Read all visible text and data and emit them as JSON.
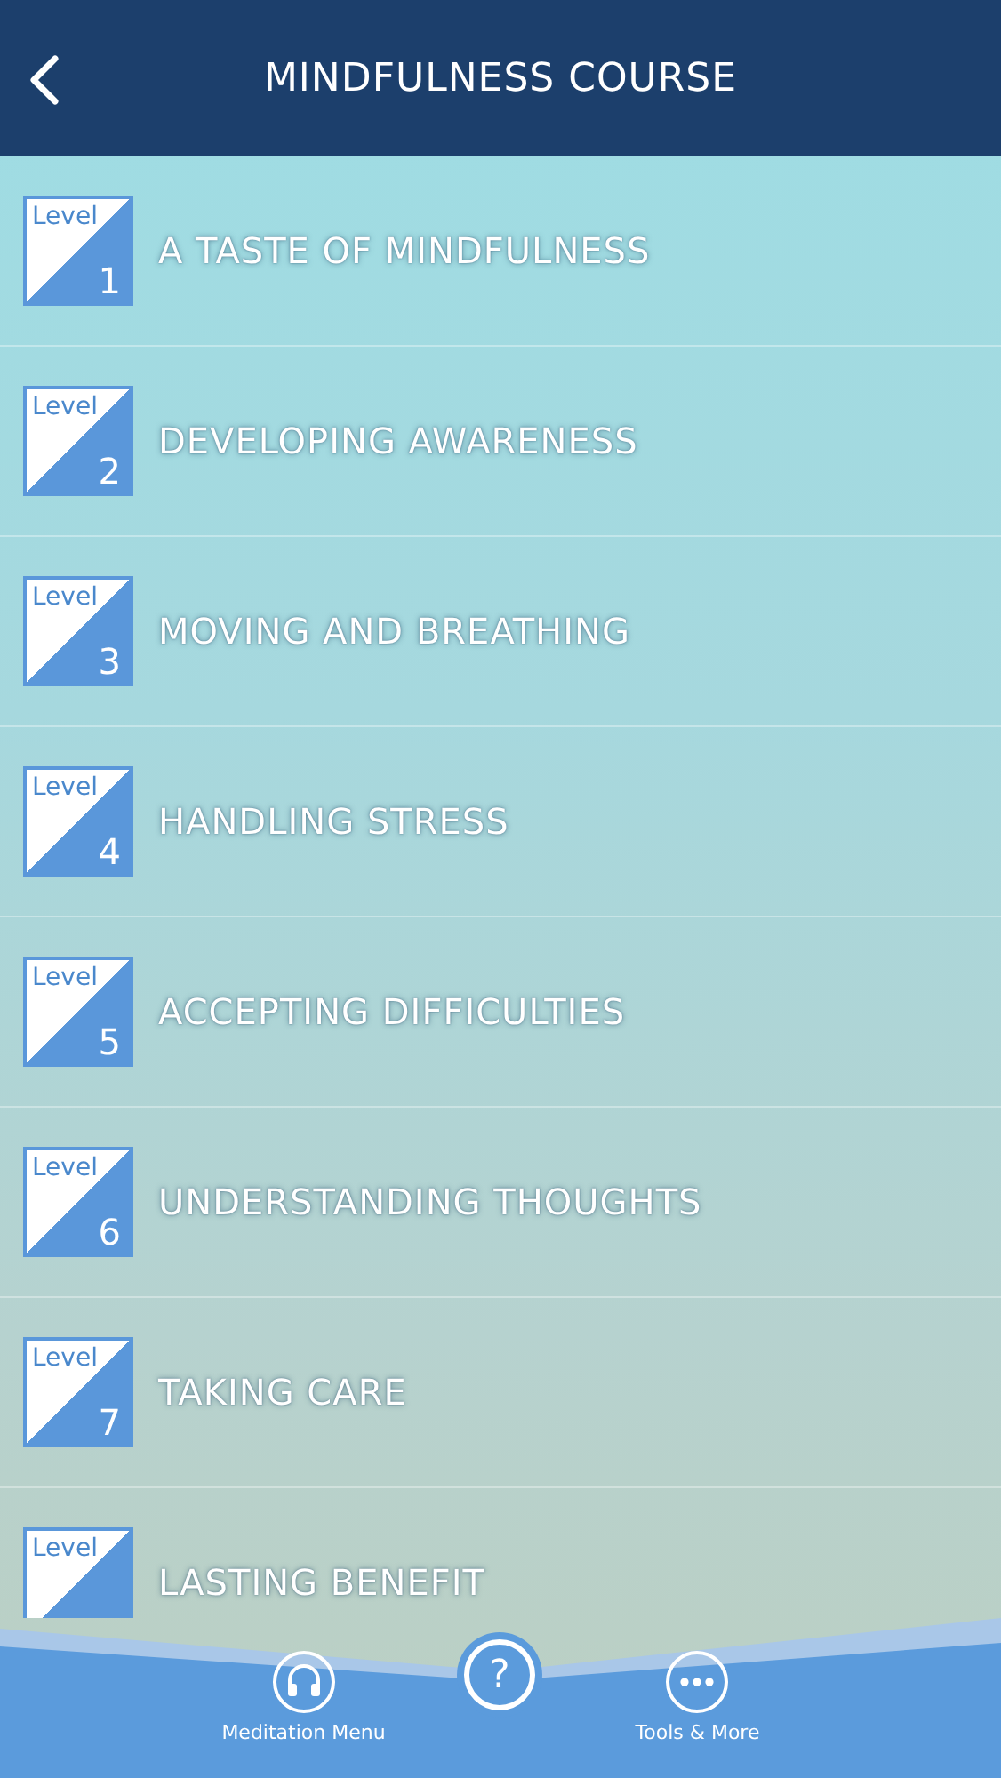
{
  "header": {
    "title": "MINDFULNESS COURSE"
  },
  "levels": [
    {
      "badge": "Level",
      "number": "1",
      "title": "A TASTE OF MINDFULNESS"
    },
    {
      "badge": "Level",
      "number": "2",
      "title": "DEVELOPING AWARENESS"
    },
    {
      "badge": "Level",
      "number": "3",
      "title": "MOVING AND BREATHING"
    },
    {
      "badge": "Level",
      "number": "4",
      "title": "HANDLING STRESS"
    },
    {
      "badge": "Level",
      "number": "5",
      "title": "ACCEPTING DIFFICULTIES"
    },
    {
      "badge": "Level",
      "number": "6",
      "title": "UNDERSTANDING THOUGHTS"
    },
    {
      "badge": "Level",
      "number": "7",
      "title": "TAKING CARE"
    },
    {
      "badge": "Level",
      "title": "LASTING BENEFIT"
    }
  ],
  "help_button": {
    "label": "?"
  },
  "tab_bar": [
    {
      "kind": "headphones",
      "label": "Meditation Menu"
    },
    {
      "kind": "more",
      "label": "Tools & More"
    }
  ]
}
